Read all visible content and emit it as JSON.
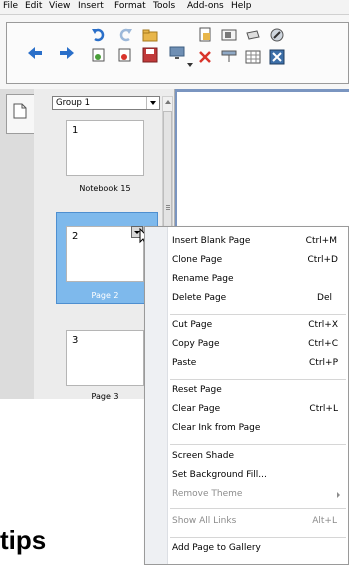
{
  "menubar": {
    "items": [
      "File",
      "Edit",
      "View",
      "Insert",
      "Format",
      "Tools",
      "Add-ons",
      "Help"
    ]
  },
  "toolbar": {
    "icons": [
      "back-arrow",
      "forward-arrow",
      "undo",
      "redo",
      "open-file",
      "screen-share",
      "new-page",
      "delete",
      "insert-page",
      "save",
      "add-page",
      "delete-page",
      "screen-shade",
      "table",
      "properties"
    ]
  },
  "sorter": {
    "group_label": "Group 1",
    "pages": [
      {
        "number": "1",
        "label": "Notebook 15"
      },
      {
        "number": "2",
        "label": "Page 2"
      },
      {
        "number": "3",
        "label": "Page 3"
      }
    ]
  },
  "context_menu": {
    "items": [
      {
        "label": "Insert Blank Page",
        "shortcut": "Ctrl+M",
        "disabled": false
      },
      {
        "label": "Clone Page",
        "shortcut": "Ctrl+D",
        "disabled": false
      },
      {
        "label": "Rename Page",
        "shortcut": "",
        "disabled": false
      },
      {
        "label": "Delete Page",
        "shortcut": "Del",
        "disabled": false
      },
      {
        "label": "Cut Page",
        "shortcut": "Ctrl+X",
        "disabled": false
      },
      {
        "label": "Copy Page",
        "shortcut": "Ctrl+C",
        "disabled": false
      },
      {
        "label": "Paste",
        "shortcut": "Ctrl+P",
        "disabled": false
      },
      {
        "label": "Reset Page",
        "shortcut": "",
        "disabled": false
      },
      {
        "label": "Clear Page",
        "shortcut": "Ctrl+L",
        "disabled": false
      },
      {
        "label": "Clear Ink from Page",
        "shortcut": "",
        "disabled": false
      },
      {
        "label": "Screen Shade",
        "shortcut": "",
        "disabled": false
      },
      {
        "label": "Set Background Fill...",
        "shortcut": "",
        "disabled": false
      },
      {
        "label": "Remove Theme",
        "shortcut": "",
        "disabled": true
      },
      {
        "label": "Show All Links",
        "shortcut": "Alt+L",
        "disabled": true
      },
      {
        "label": "Add Page to Gallery",
        "shortcut": "",
        "disabled": false
      }
    ]
  },
  "footer": {
    "text": "tips"
  },
  "colors": {
    "selection": "#7eb9ec",
    "arrow_blue": "#2a6fc9",
    "delete_red": "#d9342b"
  }
}
